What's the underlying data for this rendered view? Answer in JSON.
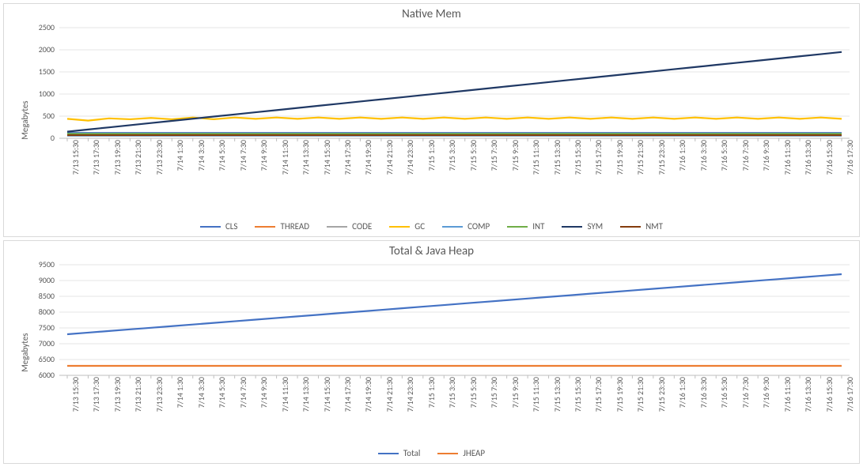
{
  "chart_data": [
    {
      "id": "native_mem",
      "type": "line",
      "title": "Native Mem",
      "ylabel": "Megabytes",
      "xlabel": "",
      "ylim": [
        0,
        2500
      ],
      "yticks": [
        0,
        500,
        1000,
        1500,
        2000,
        2500
      ],
      "categories": [
        "7/13 15:30",
        "7/13 17:30",
        "7/13 19:30",
        "7/13 21:30",
        "7/13 23:30",
        "7/14 1:30",
        "7/14 3:30",
        "7/14 5:30",
        "7/14 7:30",
        "7/14 9:30",
        "7/14 11:30",
        "7/14 13:30",
        "7/14 15:30",
        "7/14 17:30",
        "7/14 19:30",
        "7/14 21:30",
        "7/14 23:30",
        "7/15 1:30",
        "7/15 3:30",
        "7/15 5:30",
        "7/15 7:30",
        "7/15 9:30",
        "7/15 11:30",
        "7/15 13:30",
        "7/15 15:30",
        "7/15 17:30",
        "7/15 19:30",
        "7/15 21:30",
        "7/15 23:30",
        "7/16 1:30",
        "7/16 3:30",
        "7/16 5:30",
        "7/16 7:30",
        "7/16 9:30",
        "7/16 11:30",
        "7/16 13:30",
        "7/16 15:30",
        "7/16 17:30"
      ],
      "series": [
        {
          "name": "CLS",
          "color": "#4472C4",
          "values": [
            120,
            120,
            120,
            120,
            120,
            120,
            120,
            120,
            120,
            120,
            120,
            120,
            120,
            120,
            120,
            120,
            120,
            120,
            120,
            120,
            120,
            120,
            120,
            120,
            120,
            120,
            120,
            120,
            120,
            120,
            120,
            120,
            120,
            120,
            120,
            120,
            120,
            120
          ]
        },
        {
          "name": "THREAD",
          "color": "#ED7D31",
          "values": [
            80,
            80,
            80,
            80,
            80,
            80,
            80,
            80,
            80,
            80,
            80,
            80,
            80,
            80,
            80,
            80,
            80,
            80,
            80,
            80,
            80,
            80,
            80,
            80,
            80,
            80,
            80,
            80,
            80,
            80,
            80,
            80,
            80,
            80,
            80,
            80,
            80,
            80
          ]
        },
        {
          "name": "CODE",
          "color": "#A5A5A5",
          "values": [
            90,
            90,
            90,
            90,
            90,
            90,
            90,
            90,
            90,
            90,
            90,
            90,
            90,
            90,
            90,
            90,
            90,
            90,
            90,
            90,
            90,
            90,
            90,
            90,
            90,
            90,
            90,
            90,
            90,
            90,
            90,
            90,
            90,
            90,
            90,
            90,
            90,
            90
          ]
        },
        {
          "name": "GC",
          "color": "#FFC000",
          "values": [
            440,
            400,
            450,
            430,
            460,
            430,
            470,
            430,
            470,
            440,
            470,
            440,
            470,
            440,
            470,
            440,
            470,
            440,
            470,
            440,
            470,
            440,
            470,
            440,
            470,
            440,
            470,
            440,
            470,
            440,
            470,
            440,
            470,
            440,
            470,
            440,
            470,
            440
          ]
        },
        {
          "name": "COMP",
          "color": "#5B9BD5",
          "values": [
            60,
            60,
            60,
            60,
            60,
            60,
            60,
            60,
            60,
            60,
            60,
            60,
            60,
            60,
            60,
            60,
            60,
            60,
            60,
            60,
            60,
            60,
            60,
            60,
            60,
            60,
            60,
            60,
            60,
            60,
            60,
            60,
            60,
            60,
            60,
            60,
            60,
            60
          ]
        },
        {
          "name": "INT",
          "color": "#70AD47",
          "values": [
            100,
            100,
            100,
            100,
            100,
            100,
            100,
            100,
            100,
            100,
            100,
            100,
            100,
            100,
            100,
            100,
            100,
            100,
            100,
            100,
            100,
            100,
            100,
            100,
            100,
            100,
            100,
            100,
            100,
            100,
            100,
            100,
            100,
            100,
            100,
            100,
            100,
            100
          ]
        },
        {
          "name": "SYM",
          "color": "#1F3864",
          "values": [
            150,
            199,
            247,
            296,
            345,
            393,
            442,
            491,
            539,
            588,
            636,
            685,
            734,
            782,
            831,
            880,
            928,
            977,
            1026,
            1074,
            1123,
            1172,
            1220,
            1269,
            1318,
            1366,
            1415,
            1464,
            1512,
            1561,
            1609,
            1658,
            1707,
            1755,
            1804,
            1853,
            1901,
            1950
          ]
        },
        {
          "name": "NMT",
          "color": "#843C0C",
          "values": [
            70,
            70,
            70,
            70,
            70,
            70,
            70,
            70,
            70,
            70,
            70,
            70,
            70,
            70,
            70,
            70,
            70,
            70,
            70,
            70,
            70,
            70,
            70,
            70,
            70,
            70,
            70,
            70,
            70,
            70,
            70,
            70,
            70,
            70,
            70,
            70,
            70,
            70
          ]
        }
      ]
    },
    {
      "id": "total_heap",
      "type": "line",
      "title": "Total & Java Heap",
      "ylabel": "Megabytes",
      "xlabel": "",
      "ylim": [
        6000,
        9500
      ],
      "yticks": [
        6000,
        6500,
        7000,
        7500,
        8000,
        8500,
        9000,
        9500
      ],
      "categories": [
        "7/13 15:30",
        "7/13 17:30",
        "7/13 19:30",
        "7/13 21:30",
        "7/13 23:30",
        "7/14 1:30",
        "7/14 3:30",
        "7/14 5:30",
        "7/14 7:30",
        "7/14 9:30",
        "7/14 11:30",
        "7/14 13:30",
        "7/14 15:30",
        "7/14 17:30",
        "7/14 19:30",
        "7/14 21:30",
        "7/14 23:30",
        "7/15 1:30",
        "7/15 3:30",
        "7/15 5:30",
        "7/15 7:30",
        "7/15 9:30",
        "7/15 11:30",
        "7/15 13:30",
        "7/15 15:30",
        "7/15 17:30",
        "7/15 19:30",
        "7/15 21:30",
        "7/15 23:30",
        "7/16 1:30",
        "7/16 3:30",
        "7/16 5:30",
        "7/16 7:30",
        "7/16 9:30",
        "7/16 11:30",
        "7/16 13:30",
        "7/16 15:30",
        "7/16 17:30"
      ],
      "series": [
        {
          "name": "Total",
          "color": "#4472C4",
          "values": [
            7300,
            7351,
            7403,
            7454,
            7505,
            7557,
            7608,
            7659,
            7711,
            7762,
            7814,
            7865,
            7916,
            7968,
            8019,
            8070,
            8122,
            8173,
            8224,
            8276,
            8327,
            8378,
            8430,
            8481,
            8532,
            8584,
            8635,
            8686,
            8738,
            8789,
            8841,
            8892,
            8943,
            8995,
            9046,
            9097,
            9149,
            9200
          ]
        },
        {
          "name": "JHEAP",
          "color": "#ED7D31",
          "values": [
            6300,
            6300,
            6300,
            6300,
            6300,
            6300,
            6300,
            6300,
            6300,
            6300,
            6300,
            6300,
            6300,
            6300,
            6300,
            6300,
            6300,
            6300,
            6300,
            6300,
            6300,
            6300,
            6300,
            6300,
            6300,
            6300,
            6300,
            6300,
            6300,
            6300,
            6300,
            6300,
            6300,
            6300,
            6300,
            6300,
            6300,
            6300
          ]
        }
      ]
    }
  ]
}
